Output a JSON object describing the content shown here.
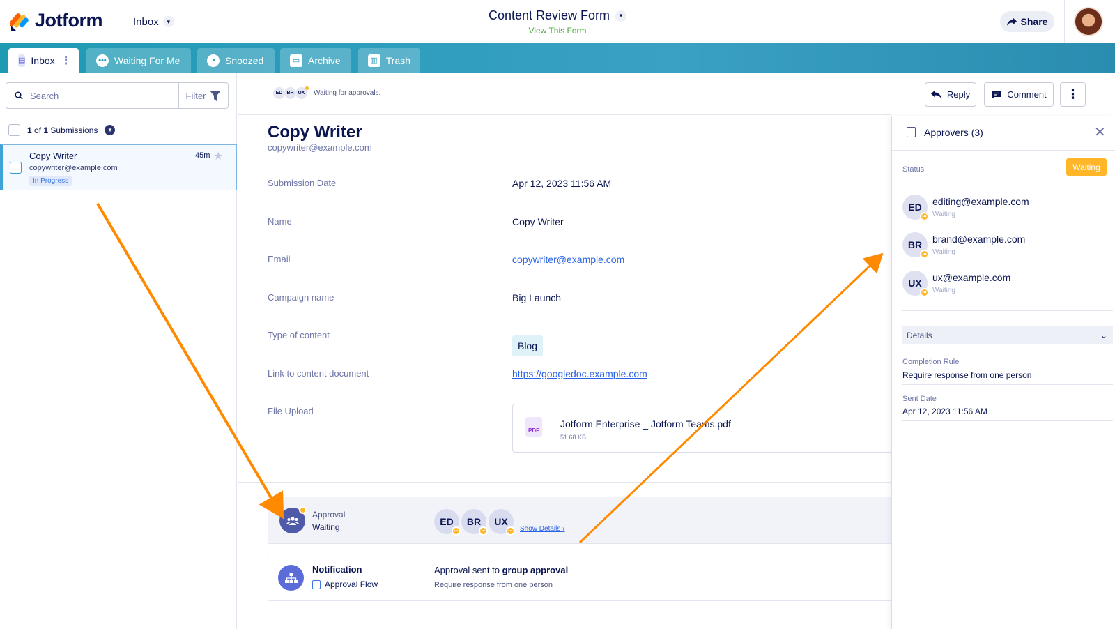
{
  "header": {
    "brand": "Jotform",
    "inbox_label": "Inbox",
    "form_title": "Content Review Form",
    "view_form_link": "View This Form",
    "share_label": "Share"
  },
  "tabs": [
    {
      "label": "Inbox",
      "active": true
    },
    {
      "label": "Waiting For Me",
      "active": false
    },
    {
      "label": "Snoozed",
      "active": false
    },
    {
      "label": "Archive",
      "active": false
    },
    {
      "label": "Trash",
      "active": false
    }
  ],
  "left": {
    "search_placeholder": "Search",
    "filter_label": "Filter",
    "count_prefix": "1",
    "count_text": "of",
    "count_total": "1",
    "count_suffix": "Submissions",
    "submission": {
      "name": "Copy Writer",
      "email": "copywriter@example.com",
      "status": "In Progress",
      "time": "45m"
    }
  },
  "main": {
    "mini_avatars": [
      "ED",
      "BR",
      "UX"
    ],
    "waiting_text": "Waiting for approvals.",
    "reply_label": "Reply",
    "comment_label": "Comment",
    "title": "Copy Writer",
    "email": "copywriter@example.com",
    "fields": [
      {
        "label": "Submission Date",
        "value": "Apr 12, 2023 11:56 AM"
      },
      {
        "label": "Name",
        "value": "Copy Writer"
      },
      {
        "label": "Email",
        "value": "copywriter@example.com"
      },
      {
        "label": "Campaign name",
        "value": "Big Launch"
      },
      {
        "label": "Type of content",
        "value": "Blog"
      },
      {
        "label": "Link to content document",
        "value": "https://googledoc.example.com"
      },
      {
        "label": "File Upload",
        "value": ""
      }
    ],
    "file": {
      "name": "Jotform Enterprise _ Jotform Teams.pdf",
      "size": "51.68 KB",
      "icon_text": "PDF"
    },
    "approval": {
      "label": "Approval",
      "status": "Waiting",
      "avatars": [
        "ED",
        "BR",
        "UX"
      ],
      "show_details": "Show Details"
    },
    "notification": {
      "title": "Notification",
      "subtitle": "Approval Flow",
      "message_prefix": "Approval sent to",
      "message_bold": "group approval",
      "note": "Require response from one person"
    }
  },
  "right": {
    "title": "Approvers (3)",
    "status_label": "Status",
    "status_value": "Waiting",
    "approvers": [
      {
        "initials": "ED",
        "email": "editing@example.com",
        "status": "Waiting"
      },
      {
        "initials": "BR",
        "email": "brand@example.com",
        "status": "Waiting"
      },
      {
        "initials": "UX",
        "email": "ux@example.com",
        "status": "Waiting"
      }
    ],
    "details_label": "Details",
    "completion_rule_label": "Completion Rule",
    "completion_rule_value": "Require response from one person",
    "sent_date_label": "Sent Date",
    "sent_date_value": "Apr 12, 2023 11:56 AM"
  },
  "colors": {
    "accent_waiting": "#ffb629",
    "tabbar": "#2a9bbb",
    "annotation_arrow": "#ff8a00"
  }
}
